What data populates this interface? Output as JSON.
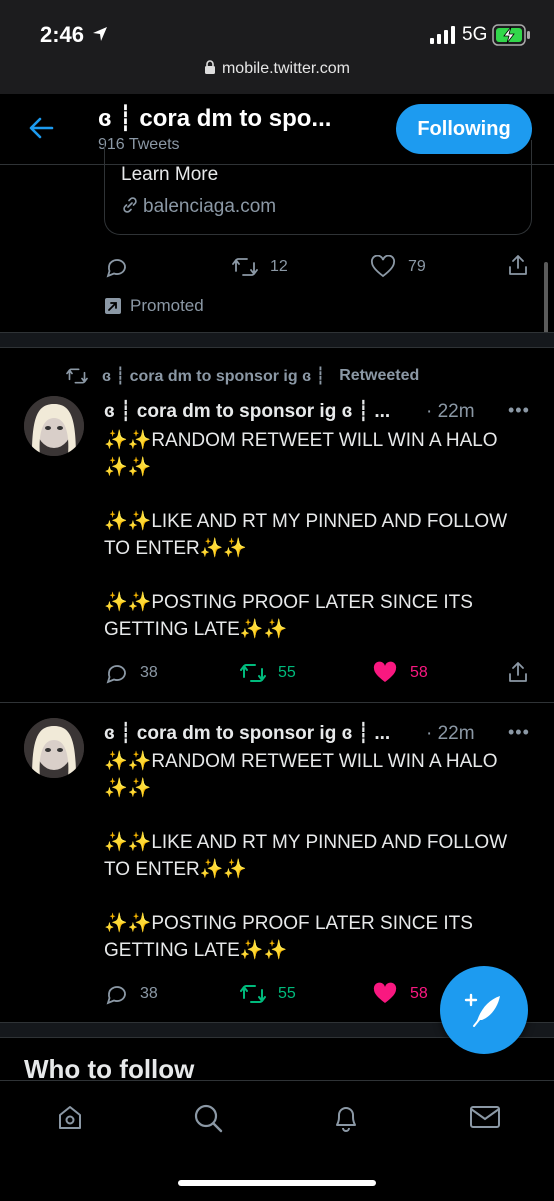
{
  "status": {
    "time": "2:46",
    "network": "5G",
    "url": "mobile.twitter.com"
  },
  "header": {
    "title": "ɞ ┊ cora dm to spo...",
    "tweet_count": "916 Tweets",
    "follow_label": "Following"
  },
  "promo": {
    "card_title": "Learn More",
    "card_link": "balenciaga.com",
    "replies": "",
    "retweets": "12",
    "likes": "79",
    "promoted_label": "Promoted"
  },
  "retweet_context": {
    "name": "ɞ ┊ cora dm to sponsor ig ɞ ┊",
    "label": "Retweeted"
  },
  "tweets": [
    {
      "name": "ɞ ┊ cora dm to sponsor ig ɞ ┊ ...",
      "time": "· 22m",
      "line1": "✨✨RANDOM RETWEET WILL WIN A HALO ✨✨",
      "line2": "✨✨LIKE AND RT MY PINNED AND FOLLOW TO ENTER✨✨",
      "line3": "✨✨POSTING PROOF LATER SINCE ITS GETTING LATE✨✨",
      "replies": "38",
      "retweets": "55",
      "likes": "58"
    },
    {
      "name": "ɞ ┊ cora dm to sponsor ig ɞ ┊ ...",
      "time": "· 22m",
      "line1": "✨✨RANDOM RETWEET WILL WIN A HALO ✨✨",
      "line2": "✨✨LIKE AND RT MY PINNED AND FOLLOW TO ENTER✨✨",
      "line3": "✨✨POSTING PROOF LATER SINCE ITS GETTING LATE✨✨",
      "replies": "38",
      "retweets": "55",
      "likes": "58"
    }
  ],
  "section": {
    "who_to_follow": "Who to follow"
  },
  "icons": {
    "back": "arrow-left-icon",
    "compose": "feather-plus-icon",
    "tabs": [
      "home-icon",
      "search-icon",
      "bell-icon",
      "mail-icon"
    ]
  },
  "colors": {
    "accent": "#1d9bf0",
    "retweet_green": "#00ba7c",
    "like_pink": "#f91880",
    "muted": "#8b98a5"
  }
}
